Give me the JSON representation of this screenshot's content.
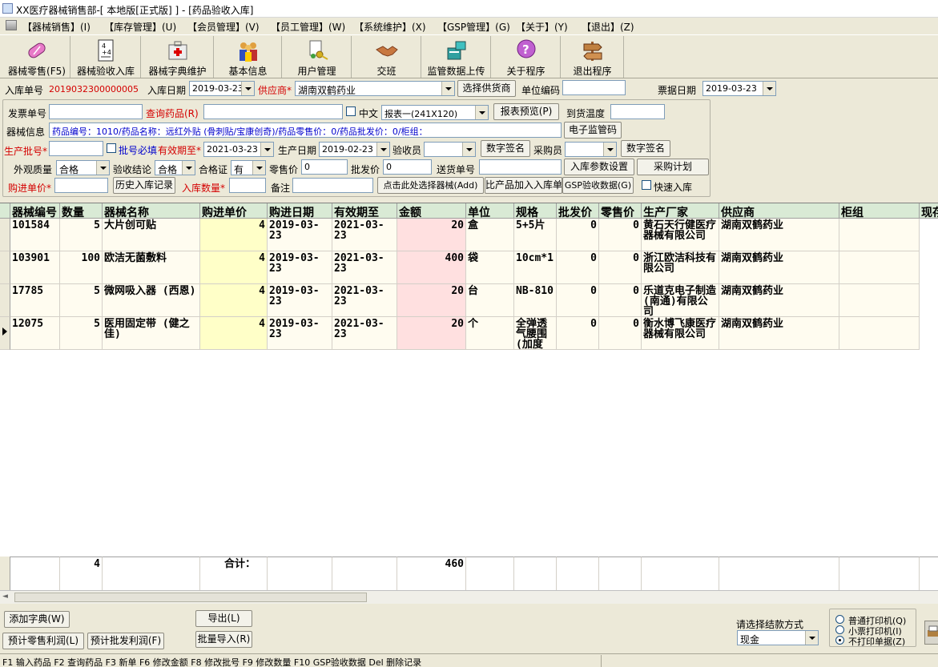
{
  "window": {
    "title": "XX医疗器械销售部-[ 本地版[正式版] ] - [药品验收入库]"
  },
  "menu": [
    "【器械销售】(I)",
    "【库存管理】(U)",
    "【会员管理】(V)",
    "【员工管理】(W)",
    "【系统维护】(X)",
    "【GSP管理】(G)",
    "【关于】(Y)",
    "【退出】(Z)"
  ],
  "toolbar": [
    "器械零售(F5)",
    "器械验收入库",
    "器械字典维护",
    "基本信息",
    "用户管理",
    "交班",
    "监管数据上传",
    "关于程序",
    "退出程序"
  ],
  "form": {
    "entry_no_label": "入库单号",
    "entry_no": "2019032300000005",
    "entry_date_label": "入库日期",
    "entry_date": "2019-03-23",
    "supplier_label": "供应商*",
    "supplier": "湖南双鹤药业",
    "choose_supplier": "选择供货商",
    "unit_code_label": "单位编码",
    "unit_code": "",
    "bill_date_label": "票据日期",
    "bill_date": "2019-03-23",
    "invoice_label": "发票单号",
    "invoice": "",
    "query_drug_label": "查询药品(R)",
    "query_drug": "",
    "chinese_label": "中文",
    "report_select": "报表一(241X120)",
    "report_preview": "报表预览(P)",
    "arrival_temp_label": "到货温度",
    "arrival_temp": "",
    "device_info_label": "器械信息",
    "device_info": "药品编号：1010/药品名称：远红外贴 (骨刺贴/宝康创奇)/药品零售价：0/药品批发价：0/柜组：",
    "e_code_btn": "电子监管码",
    "batch_label": "生产批号*",
    "batch": "",
    "batch_required": "批号必填",
    "expiry_label": "有效期至*",
    "expiry": "2021-03-23",
    "prod_date_label": "生产日期",
    "prod_date": "2019-02-23",
    "inspector_label": "验收员",
    "inspector": "",
    "sign1": "数字签名",
    "buyer_label": "采购员",
    "buyer": "",
    "sign2": "数字签名",
    "appearance_label": "外观质量",
    "appearance": "合格",
    "conclusion_label": "验收结论",
    "conclusion": "合格",
    "cert_label": "合格证",
    "cert": "有",
    "retail_label": "零售价",
    "retail": "0",
    "wholesale_label": "批发价",
    "wholesale": "0",
    "delivery_label": "送货单号",
    "delivery": "",
    "param_btn": "入库参数设置",
    "plan_btn": "采购计划",
    "buy_price_label": "购进单价*",
    "buy_price": "",
    "history_btn": "历史入库记录",
    "qty_label": "入库数量*",
    "qty": "",
    "remark_label": "备注",
    "remark": "",
    "select_device_btn": "点击此处选择器械(Add)",
    "add_btn": "比产品加入入库单",
    "gsp_btn": "GSP验收数据(G)",
    "quick_label": "快速入库"
  },
  "table": {
    "headers": [
      "器械编号",
      "数量",
      "器械名称",
      "购进单价",
      "购进日期",
      "有效期至",
      "金额",
      "单位",
      "规格",
      "批发价",
      "零售价",
      "生产厂家",
      "供应商",
      "柜组",
      "现存"
    ],
    "rows": [
      [
        "101584",
        "5",
        "大片创可贴",
        "4",
        "2019-03-23",
        "2021-03-23",
        "20",
        "盒",
        "5+5片",
        "0",
        "0",
        "黄石天行健医疗器械有限公司",
        "湖南双鹤药业",
        ""
      ],
      [
        "103901",
        "100",
        "欧洁无菌敷料",
        "4",
        "2019-03-23",
        "2021-03-23",
        "400",
        "袋",
        "10cm*1",
        "0",
        "0",
        "浙江欧洁科技有限公司",
        "湖南双鹤药业",
        ""
      ],
      [
        "17785",
        "5",
        "微网吸入器 (西恩)",
        "4",
        "2019-03-23",
        "2021-03-23",
        "20",
        "台",
        "NB-810",
        "0",
        "0",
        "乐道克电子制造(南通)有限公司",
        "湖南双鹤药业",
        ""
      ],
      [
        "12075",
        "5",
        "医用固定带 (健之佳)",
        "4",
        "2019-03-23",
        "2021-03-23",
        "20",
        "个",
        "全弹透气腰围(加度",
        "0",
        "0",
        "衡水博飞康医疗器械有限公司",
        "湖南双鹤药业",
        ""
      ]
    ],
    "summary": {
      "qty": "4",
      "label": "合计：",
      "amount": "460"
    }
  },
  "bottom": {
    "add_dict": "添加字典(W)",
    "export": "导出(L)",
    "est_retail": "预计零售利润(L)",
    "est_wholesale": "预计批发利润(F)",
    "batch_import": "批量导入(R)",
    "pay_label": "请选择结款方式",
    "pay_method": "现金",
    "print_opts": [
      "普通打印机(Q)",
      "小票打印机(I)",
      "不打印单据(Z)"
    ]
  },
  "status": "F1 输入药品 F2 查询药品 F3 新单  F6 修改金额 F8 修改批号 F9 修改数量 F10 GSP验收数据  Del 删除记录"
}
